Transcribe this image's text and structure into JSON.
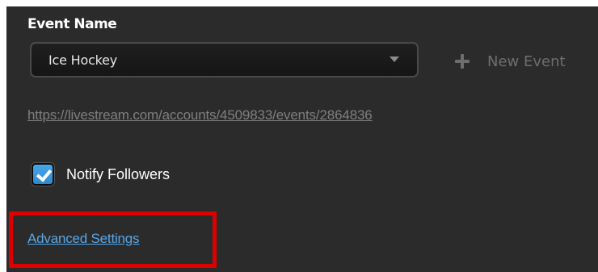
{
  "event_section": {
    "title": "Event Name",
    "selected_event": "Ice Hockey",
    "new_event_label": "New Event",
    "event_url": "https://livestream.com/accounts/4509833/events/2864836"
  },
  "notify": {
    "label": "Notify Followers",
    "checked": true
  },
  "advanced_settings_label": "Advanced Settings",
  "colors": {
    "panel_background": "#2b2b2b",
    "checkbox_accent": "#3c99dd",
    "link_blue": "#57a6e7",
    "annotation_red": "#dd0000"
  },
  "icons": {
    "dropdown": "chevron-down-icon",
    "new_event": "plus-icon",
    "checkbox": "checkmark-icon"
  }
}
